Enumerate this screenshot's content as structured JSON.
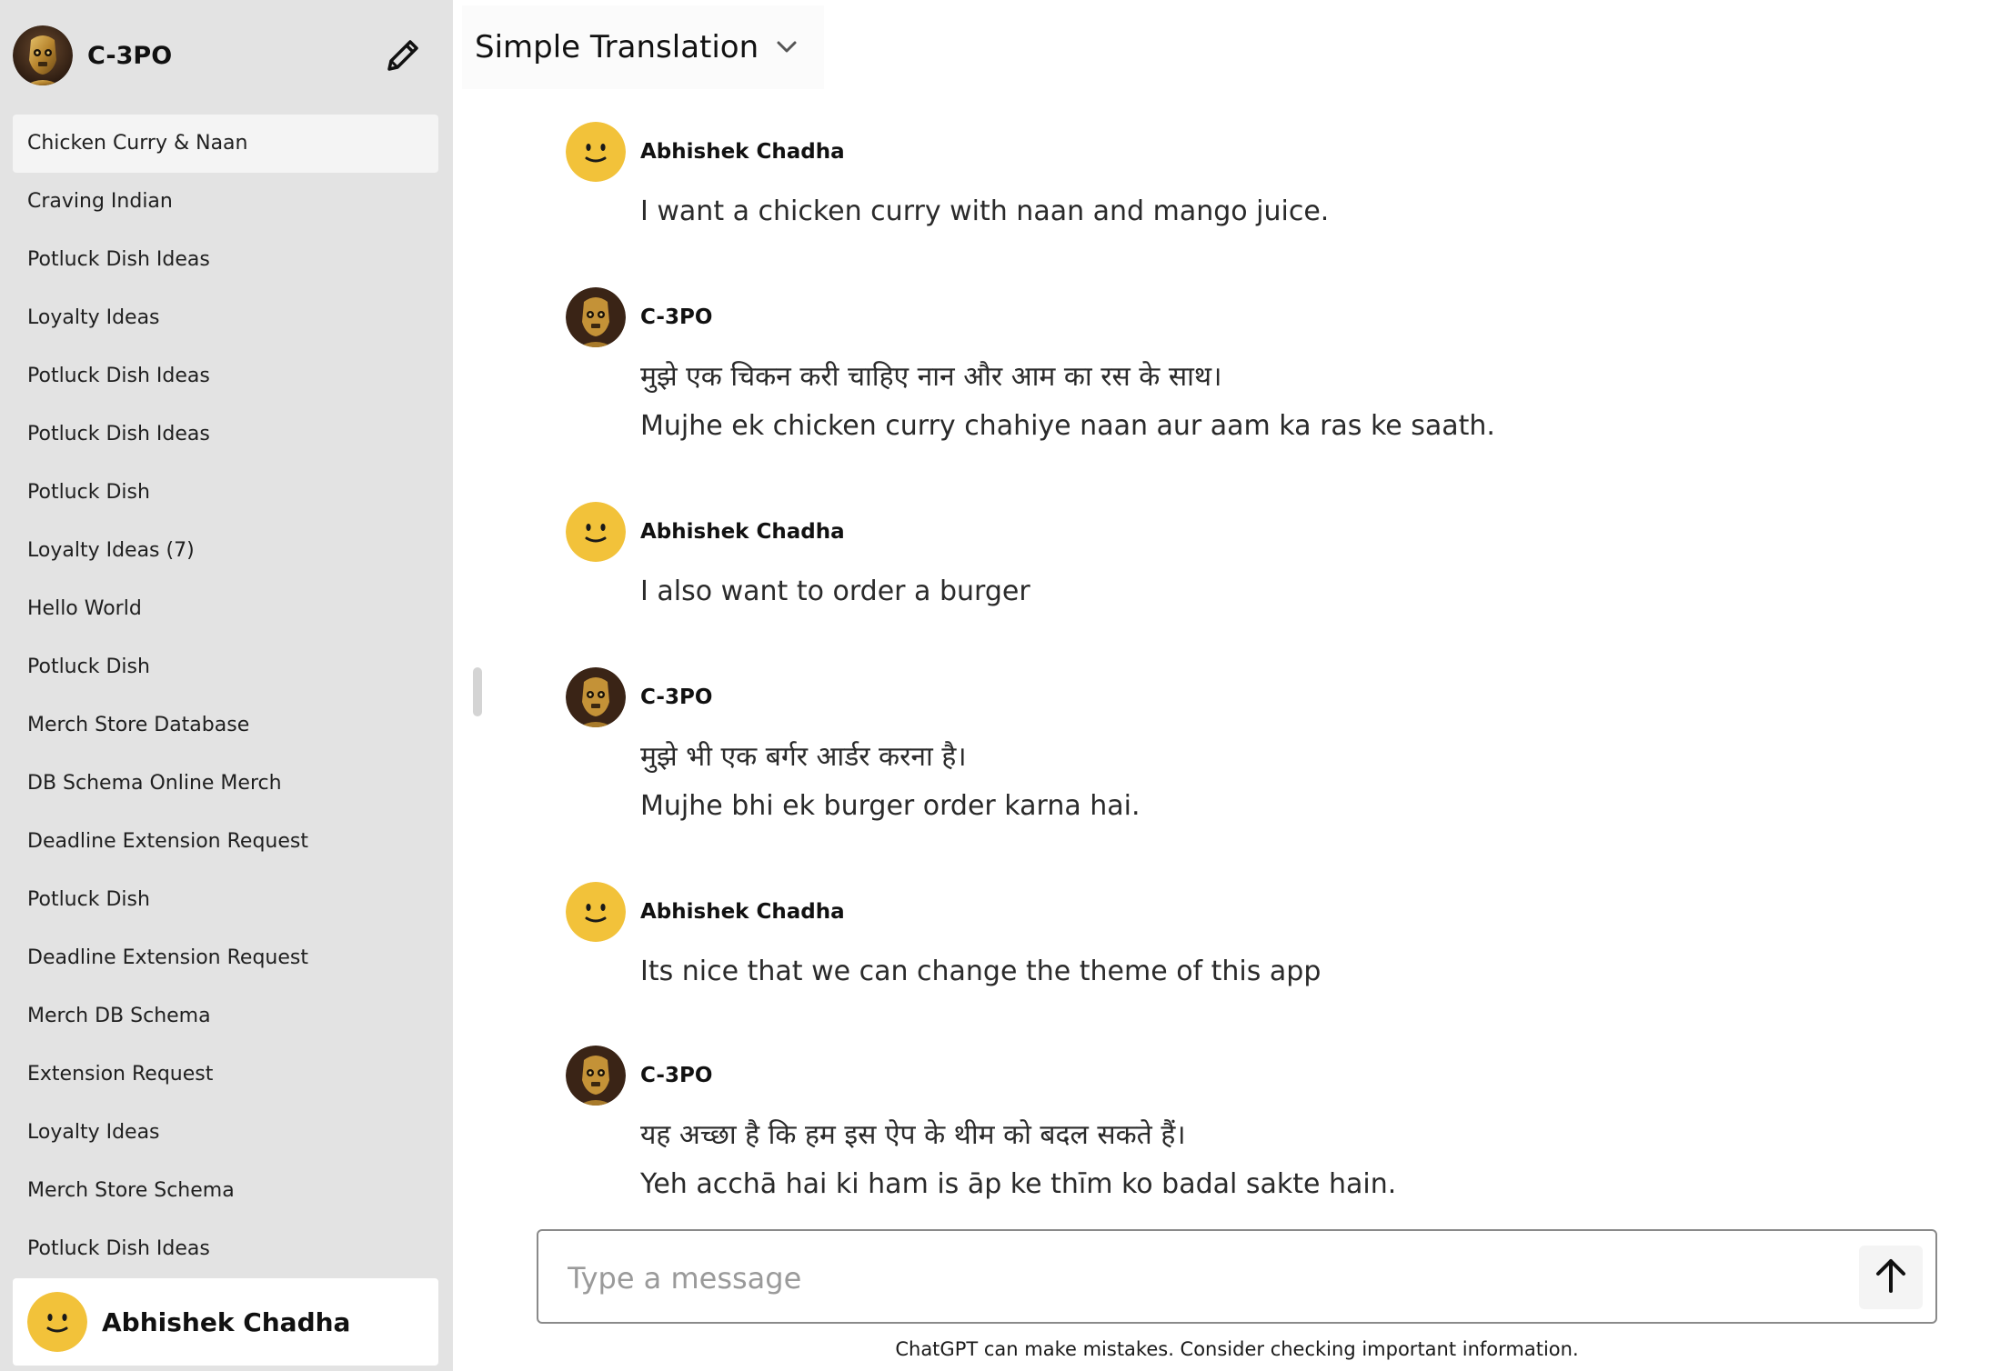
{
  "sidebar": {
    "title": "C-3PO",
    "items": [
      {
        "label": "Chicken Curry & Naan"
      },
      {
        "label": "Craving Indian"
      },
      {
        "label": "Potluck Dish Ideas"
      },
      {
        "label": "Loyalty Ideas"
      },
      {
        "label": "Potluck Dish Ideas"
      },
      {
        "label": "Potluck Dish Ideas"
      },
      {
        "label": "Potluck Dish"
      },
      {
        "label": "Loyalty Ideas (7)"
      },
      {
        "label": "Hello World"
      },
      {
        "label": "Potluck Dish"
      },
      {
        "label": "Merch Store Database"
      },
      {
        "label": "DB Schema Online Merch"
      },
      {
        "label": "Deadline Extension Request"
      },
      {
        "label": "Potluck Dish"
      },
      {
        "label": "Deadline Extension Request"
      },
      {
        "label": "Merch DB Schema"
      },
      {
        "label": "Extension Request"
      },
      {
        "label": "Loyalty Ideas"
      },
      {
        "label": "Merch Store Schema"
      },
      {
        "label": "Potluck Dish Ideas"
      }
    ],
    "user_name": "Abhishek Chadha"
  },
  "header": {
    "model_name": "Simple Translation"
  },
  "messages": [
    {
      "author": "Abhishek Chadha",
      "lines": [
        "I want a chicken curry with naan and mango juice."
      ]
    },
    {
      "author": "C-3PO",
      "lines": [
        "मुझे एक चिकन करी चाहिए नान और आम का रस के साथ।",
        "Mujhe ek chicken curry chahiye naan aur aam ka ras ke saath."
      ]
    },
    {
      "author": "Abhishek Chadha",
      "lines": [
        "I also want to order a burger"
      ]
    },
    {
      "author": "C-3PO",
      "lines": [
        "मुझे भी एक बर्गर आर्डर करना है।",
        "Mujhe bhi ek burger order karna hai."
      ]
    },
    {
      "author": "Abhishek Chadha",
      "lines": [
        "Its nice that we can change the theme of this app"
      ]
    },
    {
      "author": "C-3PO",
      "lines": [
        "यह अच्छा है कि हम इस ऐप के थीम को बदल सकते हैं।",
        "Yeh acchā hai ki ham is āp ke thīm ko badal sakte hain."
      ]
    }
  ],
  "composer": {
    "placeholder": "Type a message"
  },
  "footer": {
    "disclaimer": "ChatGPT can make mistakes. Consider checking important information."
  },
  "icons": {
    "edit": "pencil-icon",
    "model_menu": "chevron-down-icon",
    "send": "arrow-up-icon",
    "user_avatar": "smiley-avatar",
    "bot_avatar": "c3po-avatar"
  },
  "colors": {
    "sidebar_bg": "#e3e3e3",
    "active_item_bg": "#f4f4f4",
    "smiley": "#f2c23a"
  }
}
